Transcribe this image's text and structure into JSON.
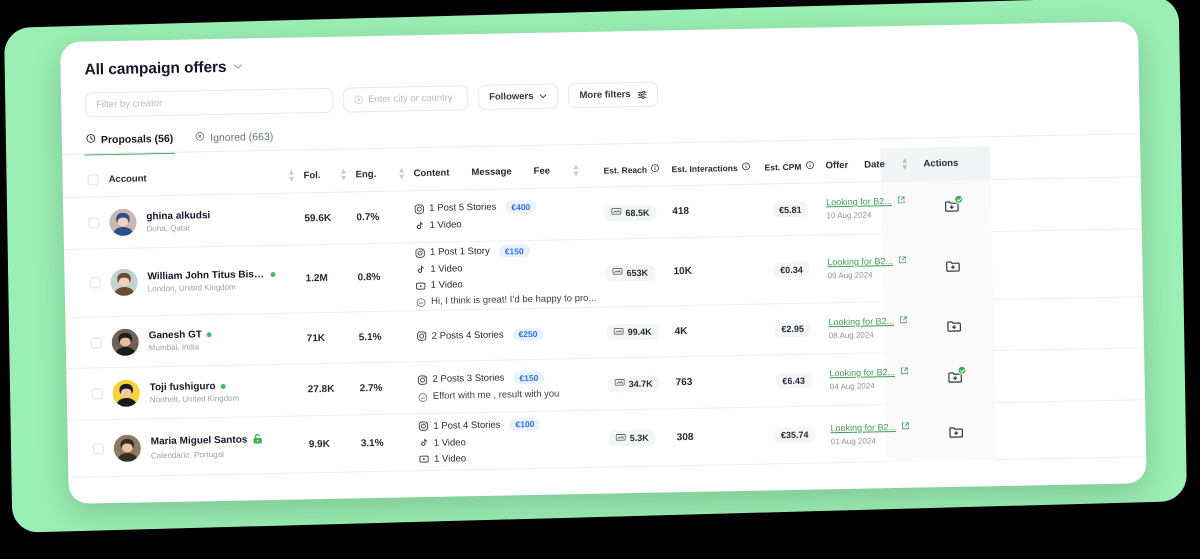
{
  "header": {
    "title": "All campaign offers",
    "chevron_icon": "chevron-down-icon"
  },
  "filters": {
    "creator_placeholder": "Filter by creator",
    "location_placeholder": "Enter city or country",
    "location_icon": "map-pin-icon",
    "followers_label": "Followers",
    "followers_icon": "chevron-down-icon",
    "more_filters_label": "More filters",
    "more_filters_icon": "sliders-icon"
  },
  "tabs": [
    {
      "label": "Proposals (56)",
      "icon": "clock-icon",
      "active": true
    },
    {
      "label": "Ignored (663)",
      "icon": "circle-x-icon",
      "active": false
    }
  ],
  "table": {
    "columns": {
      "account": "Account",
      "fol": "Fol.",
      "eng": "Eng.",
      "content": "Content",
      "message": "Message",
      "fee": "Fee",
      "est_reach": "Est. Reach",
      "est_interactions": "Est. Interactions",
      "est_cpm": "Est. CPM",
      "offer": "Offer",
      "date": "Date",
      "actions": "Actions"
    },
    "info_icon": "info-icon",
    "sort_icon": "sort-icon",
    "rows": [
      {
        "name": "ghina alkudsi",
        "location": "Doha, Qatar",
        "online": false,
        "locked": false,
        "followers": "59.6K",
        "engagement": "0.7%",
        "content": [
          {
            "icon": "instagram-icon",
            "text": "1 Post  5 Stories",
            "fee": "€400"
          },
          {
            "icon": "tiktok-icon",
            "text": "1 Video",
            "fee": ""
          }
        ],
        "est_reach": "68.5K",
        "est_interactions": "418",
        "est_cpm": "€5.81",
        "offer": "Looking for B2...",
        "date": "10 Aug 2024",
        "has_folder_badge": true
      },
      {
        "name": "William John Titus Bish...",
        "location": "London, United Kingdom",
        "online": true,
        "locked": false,
        "followers": "1.2M",
        "engagement": "0.8%",
        "content": [
          {
            "icon": "instagram-icon",
            "text": "1 Post  1 Story",
            "fee": "€150"
          },
          {
            "icon": "tiktok-icon",
            "text": "1 Video",
            "fee": ""
          },
          {
            "icon": "youtube-icon",
            "text": "1 Video",
            "fee": ""
          },
          {
            "icon": "message-icon",
            "text": "Hi, I think is great! I’d be happy to pro...",
            "fee": ""
          }
        ],
        "est_reach": "653K",
        "est_interactions": "10K",
        "est_cpm": "€0.34",
        "offer": "Looking for B2...",
        "date": "09 Aug 2024",
        "has_folder_badge": false
      },
      {
        "name": "Ganesh GT",
        "location": "Mumbai, India",
        "online": true,
        "locked": false,
        "followers": "71K",
        "engagement": "5.1%",
        "content": [
          {
            "icon": "instagram-icon",
            "text": "2 Posts  4 Stories",
            "fee": "€250"
          }
        ],
        "est_reach": "99.4K",
        "est_interactions": "4K",
        "est_cpm": "€2.95",
        "offer": "Looking for B2...",
        "date": "08 Aug 2024",
        "has_folder_badge": false
      },
      {
        "name": "Toji fushiguro",
        "location": "Northolt, United Kingdom",
        "online": true,
        "locked": false,
        "followers": "27.8K",
        "engagement": "2.7%",
        "content": [
          {
            "icon": "instagram-icon",
            "text": "2 Posts  3 Stories",
            "fee": "€150"
          },
          {
            "icon": "message-icon",
            "text": "Effort with me , result with you",
            "fee": ""
          }
        ],
        "est_reach": "34.7K",
        "est_interactions": "763",
        "est_cpm": "€6.43",
        "offer": "Looking for B2...",
        "date": "04 Aug 2024",
        "has_folder_badge": true
      },
      {
        "name": "Maria Miguel Santos",
        "location": "Calendário, Portugal",
        "online": false,
        "locked": true,
        "followers": "9.9K",
        "engagement": "3.1%",
        "content": [
          {
            "icon": "instagram-icon",
            "text": "1 Post  4 Stories",
            "fee": "€100"
          },
          {
            "icon": "tiktok-icon",
            "text": "1 Video",
            "fee": ""
          },
          {
            "icon": "youtube-icon",
            "text": "1 Video",
            "fee": ""
          }
        ],
        "est_reach": "5.3K",
        "est_interactions": "308",
        "est_cpm": "€35.74",
        "offer": "Looking for B2...",
        "date": "01 Aug 2024",
        "has_folder_badge": false
      }
    ]
  },
  "colors": {
    "accent_green": "#3FAE5A",
    "backdrop_green": "#9BEFB4",
    "fee_chip_blue": "#2F6FE0",
    "page_background": "#000000"
  }
}
